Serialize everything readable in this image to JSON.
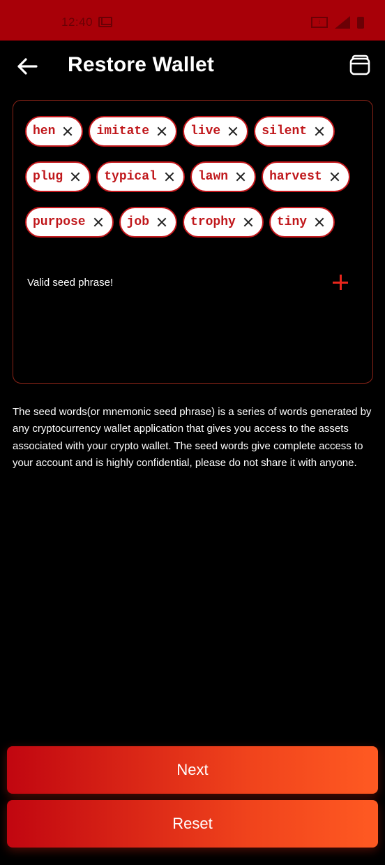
{
  "status_bar": {
    "time": "12:40"
  },
  "header": {
    "title": "Restore Wallet",
    "back_icon": "arrow-left-icon",
    "right_icon": "wallet-icon"
  },
  "seed_phrase": {
    "rows": [
      [
        "hen",
        "imitate",
        "live",
        "silent"
      ],
      [
        "plug",
        "typical",
        "lawn",
        "harvest"
      ],
      [
        "purpose",
        "job",
        "trophy",
        "tiny"
      ]
    ],
    "status_text": "Valid seed phrase!",
    "add_icon": "plus-icon"
  },
  "description": "The seed words(or mnemonic seed phrase) is a series of words generated by any cryptocurrency wallet application that gives you access to the assets associated with your crypto wallet. The seed words give complete access to your account and is highly confidential, please do not share it with anyone.",
  "buttons": {
    "next_label": "Next",
    "reset_label": "Reset"
  },
  "colors": {
    "accent": "#e8261c",
    "status_bar": "#a80008",
    "chip_border": "#c4171b",
    "chip_text": "#c0171b",
    "background": "#000000"
  }
}
